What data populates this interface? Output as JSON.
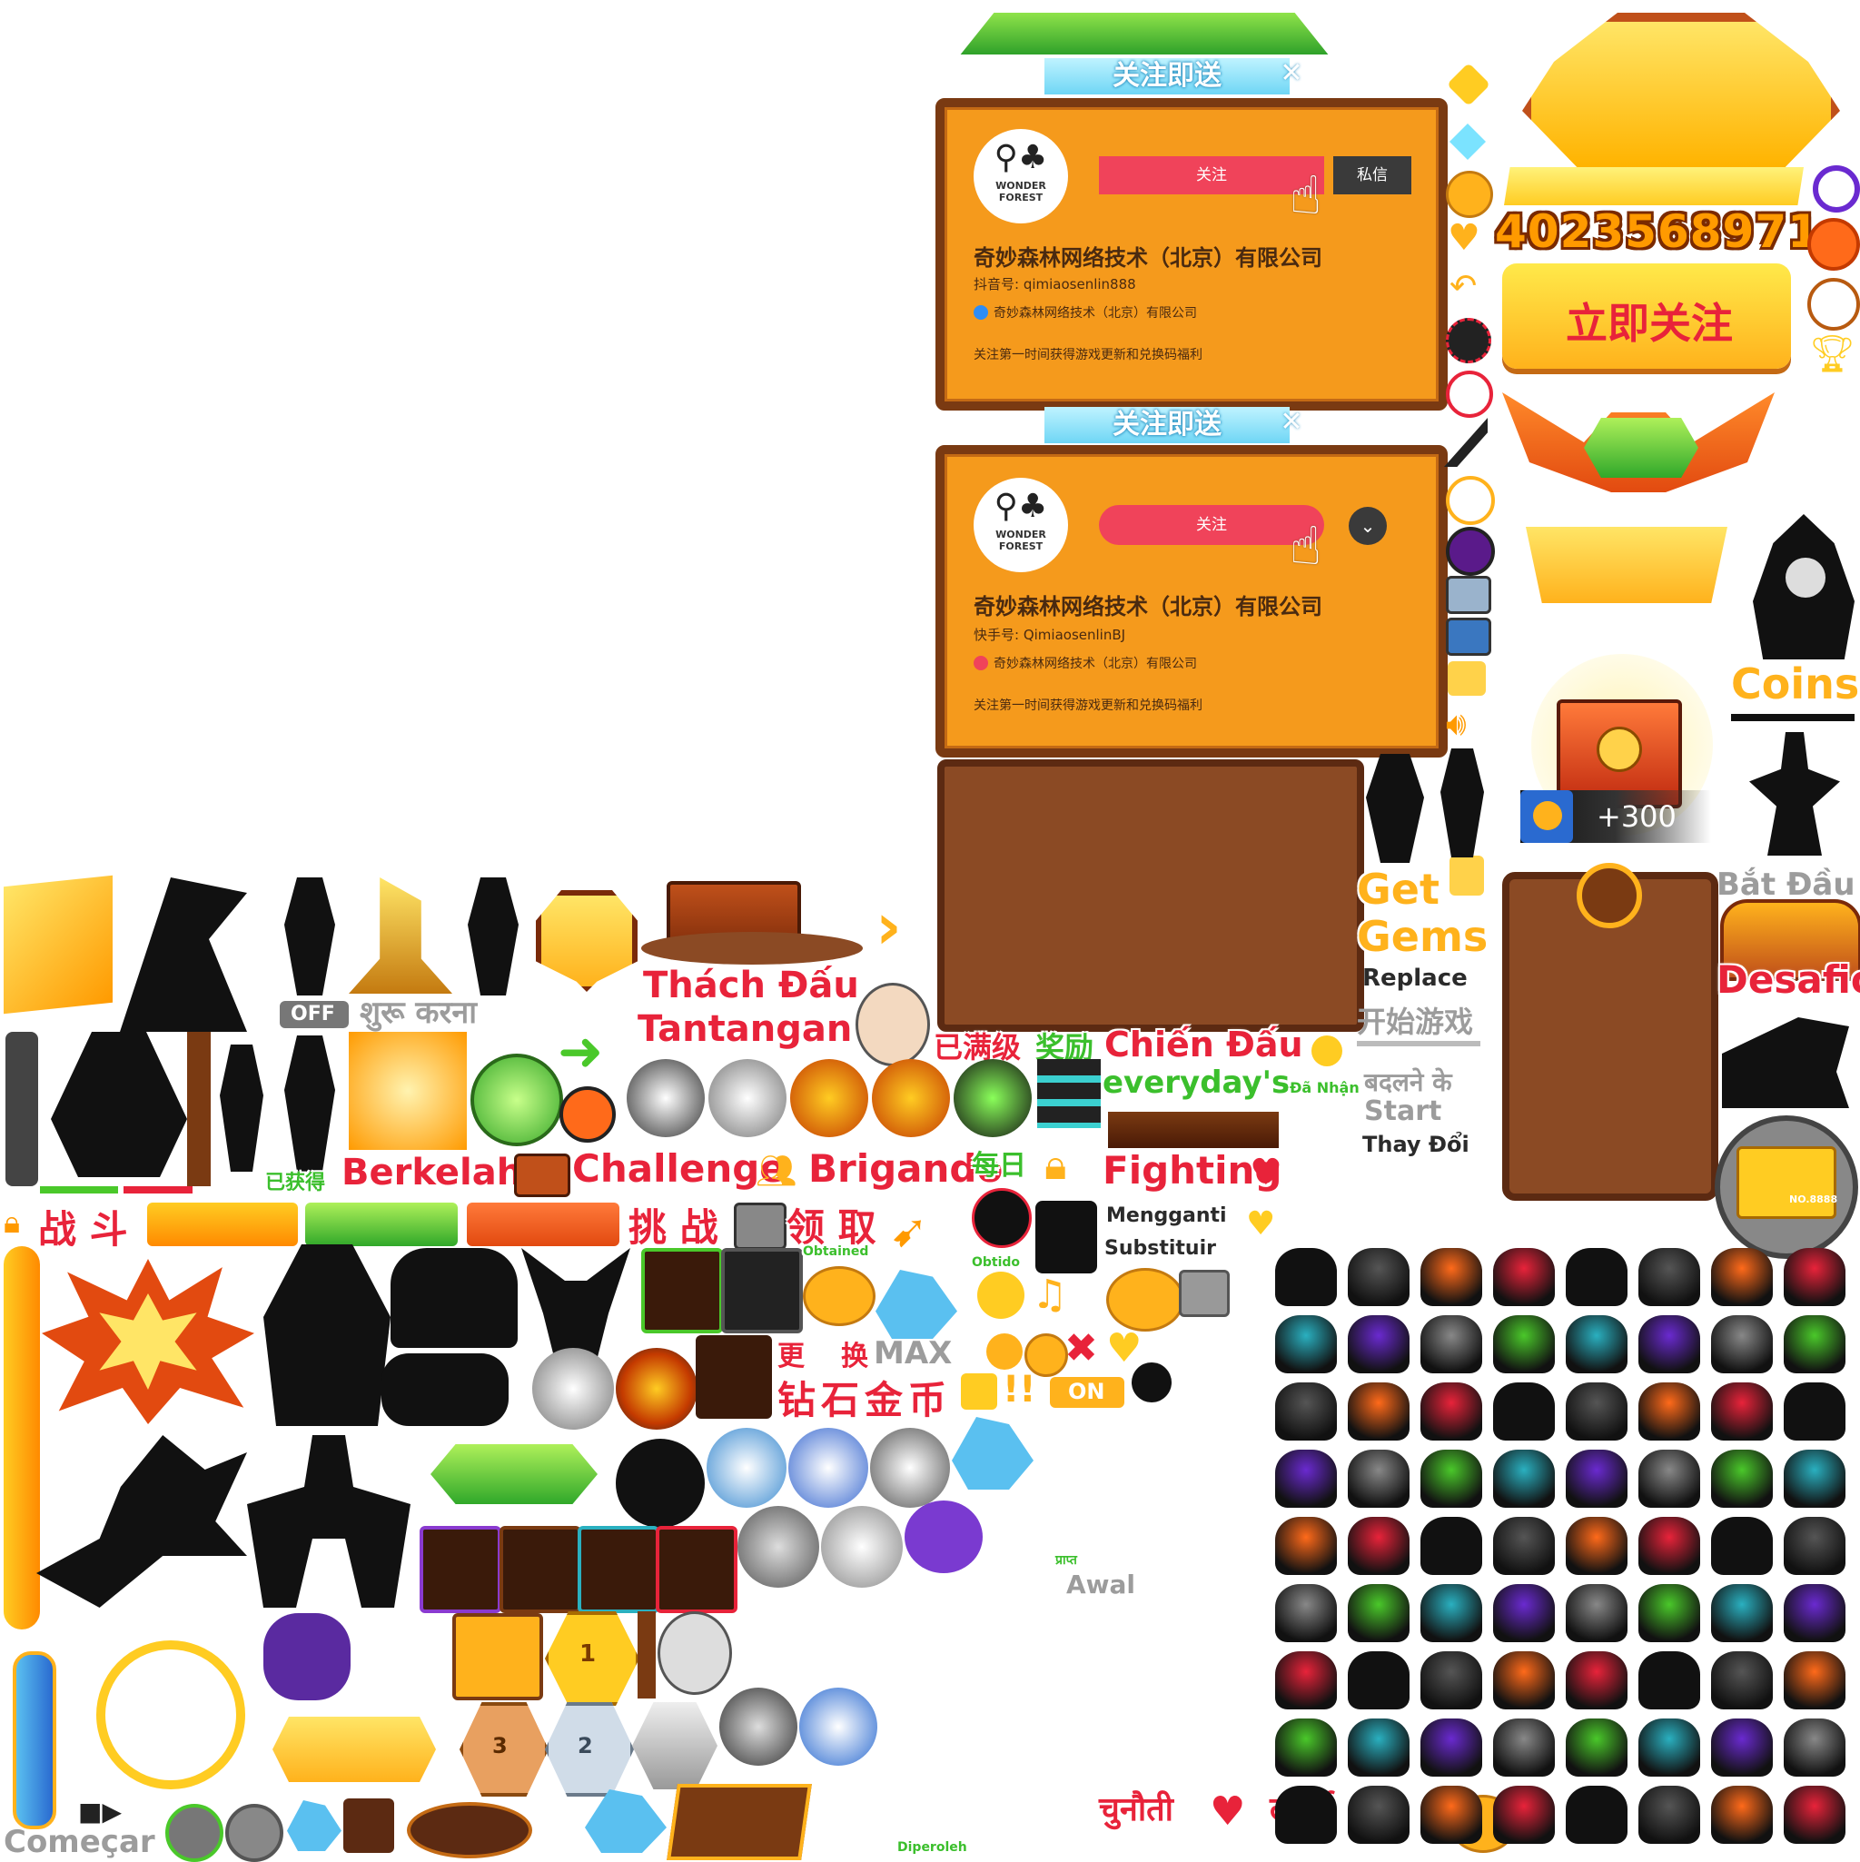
{
  "follow_panel_1": {
    "header": "关注即送",
    "logo_text": "WONDER FOREST",
    "follow_button": "关注",
    "message_button": "私信",
    "company": "奇妙森林网络技术（北京）有限公司",
    "account": "抖音号: qimiaosenlin888",
    "verified": "奇妙森林网络技术（北京）有限公司",
    "note": "关注第一时间获得游戏更新和兑换码福利"
  },
  "follow_panel_2": {
    "header": "关注即送",
    "logo_text": "WONDER FOREST",
    "follow_button": "关注",
    "company": "奇妙森林网络技术（北京）有限公司",
    "account": "快手号: QimiaosenlinBJ",
    "verified": "奇妙森林网络技术（北京）有限公司",
    "note": "关注第一时间获得游戏更新和兑换码福利"
  },
  "score_digits": "4023568971",
  "follow_now_button": "立即关注",
  "reward_amount": "+300",
  "labels": {
    "coins": "Coins",
    "bat_dau": "Bắt Đầu",
    "desafio": "Desafio",
    "get": "Get",
    "gems": "Gems",
    "replace": "Replace",
    "kaishi": "开始游戏",
    "badalne": "बदलने के",
    "start": "Start",
    "thay_doi": "Thay Đổi",
    "thach_dau": "Thách Đấu",
    "tantangan": "Tantangan",
    "yimanji": "已满级",
    "jiangli": "奖励",
    "chien_dau": "Chiến Đấu",
    "everydays": "everyday's",
    "da_nhan": "Đã Nhận",
    "off": "OFF",
    "shuru": "शुरू करना",
    "yihuode": "已获得",
    "berkelahi": "Berkelahi",
    "challenge": "Challenge",
    "brigando": "Brigando",
    "meiri": "每日",
    "fighting": "Fighting",
    "mengganti": "Mengganti",
    "substituir": "Substituir",
    "zhandou": "战 斗",
    "tiaozhan": "挑 战",
    "lingqu": "领 取",
    "obtained": "Obtained",
    "obtido": "Obtido",
    "geng": "更",
    "huan": "换",
    "max": "MAX",
    "zuanshi": "钻石金币",
    "on": "ON",
    "prapt": "प्राप्त",
    "awal": "Awal",
    "comecar": "Começar",
    "diperoleh": "Diperoleh",
    "chunauti": "चुनौती",
    "ladai": "लड़ाई",
    "no8888": "NO.8888"
  },
  "badges": {
    "rank1": "1",
    "rank2": "2",
    "rank3": "3"
  },
  "colors": {
    "panel_orange": "#f59a1c",
    "panel_border": "#7a3a12",
    "follow_red": "#f0435a",
    "label_red": "#e8233a",
    "label_gold": "#ffb21c",
    "label_green": "#3bbf2c"
  }
}
